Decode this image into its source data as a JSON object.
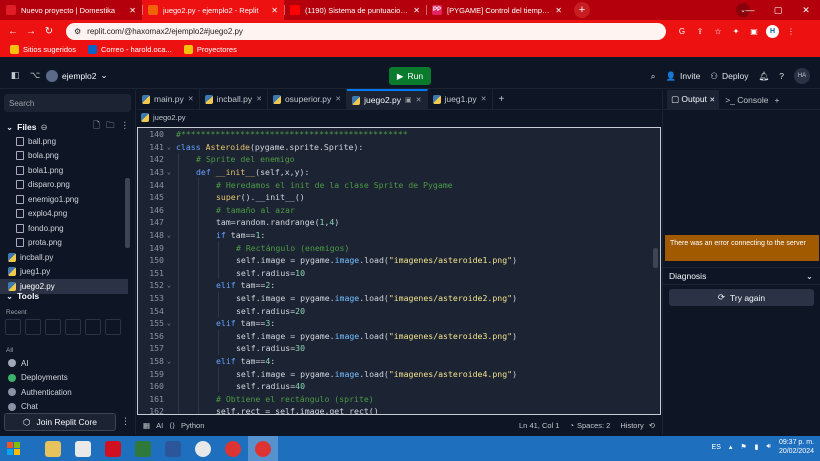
{
  "browser": {
    "tabs": [
      {
        "title": "Nuevo proyecto | Domestika",
        "favicon_color": "#e11d25",
        "favicon_label": ""
      },
      {
        "title": "juego2.py - ejemplo2 - Replit",
        "favicon_color": "#f26207",
        "favicon_label": ""
      },
      {
        "title": "(1190) Sistema de puntuaciones ...",
        "favicon_color": "#ff0000",
        "favicon_label": ""
      },
      {
        "title": "[PYGAME] Control del tiempo en ...",
        "favicon_color": "#e0245e",
        "favicon_label": "PP"
      }
    ],
    "active_tab": 1,
    "url": "replit.com/@haxomax2/ejemplo2#juego2.py",
    "profile_initial": "H",
    "bookmarks": [
      {
        "label": "Sitios sugeridos",
        "color": "#f4c20d"
      },
      {
        "label": "Correo - harold.oca...",
        "color": "#0a64c8"
      },
      {
        "label": "Proyectores",
        "color": "#f4c20d"
      }
    ]
  },
  "replit": {
    "repl_name": "ejemplo2",
    "run_label": "Run",
    "invite_label": "Invite",
    "deploy_label": "Deploy",
    "avatar": "HA",
    "sidebar": {
      "search_placeholder": "Search",
      "files_heading": "Files",
      "files": [
        {
          "name": "ball.png",
          "type": "img",
          "root": false
        },
        {
          "name": "bola.png",
          "type": "img",
          "root": false
        },
        {
          "name": "bola1.png",
          "type": "img",
          "root": false
        },
        {
          "name": "disparo.png",
          "type": "img",
          "root": false
        },
        {
          "name": "enemigo1.png",
          "type": "img",
          "root": false
        },
        {
          "name": "explo4.png",
          "type": "img",
          "root": false
        },
        {
          "name": "fondo.png",
          "type": "img",
          "root": false
        },
        {
          "name": "prota.png",
          "type": "img",
          "root": false
        },
        {
          "name": "incball.py",
          "type": "py",
          "root": true
        },
        {
          "name": "jueg1.py",
          "type": "py",
          "root": true
        },
        {
          "name": "juego2.py",
          "type": "py",
          "root": true
        }
      ],
      "tools_heading": "Tools",
      "recent_label": "Recent",
      "all_label": "All",
      "tools": [
        {
          "label": "AI",
          "color": "#a0a8b8"
        },
        {
          "label": "Deployments",
          "color": "#3bb36a"
        },
        {
          "label": "Authentication",
          "color": "#8a93a5"
        },
        {
          "label": "Chat",
          "color": "#8a93a5"
        }
      ],
      "join_label": "Join Replit Core"
    },
    "editor_tabs": [
      "main.py",
      "incball.py",
      "osuperior.py",
      "juego2.py",
      "jueg1.py"
    ],
    "active_editor_tab": 3,
    "breadcrumb": "juego2.py",
    "status": {
      "ai": "AI",
      "language": "Python",
      "position": "Ln 41, Col 1",
      "spaces": "Spaces: 2",
      "history": "History"
    },
    "right_pane": {
      "tabs": [
        "Output",
        "Console"
      ],
      "error": "There was an error connecting to the server",
      "diagnosis": "Diagnosis",
      "retry": "Try again"
    }
  },
  "code": [
    {
      "n": "140",
      "fold": "",
      "indent": 0,
      "tokens": [
        [
          "cm",
          "#**********************************************"
        ]
      ]
    },
    {
      "n": "141",
      "fold": "⌄",
      "indent": 0,
      "tokens": [
        [
          "kw",
          "class "
        ],
        [
          "fn",
          "Asteroide"
        ],
        [
          "code",
          "(pygame.sprite.Sprite):"
        ]
      ]
    },
    {
      "n": "142",
      "fold": "",
      "indent": 1,
      "tokens": [
        [
          "cm",
          "# Sprite del enemigo"
        ]
      ]
    },
    {
      "n": "143",
      "fold": "⌄",
      "indent": 1,
      "tokens": [
        [
          "kw",
          "def "
        ],
        [
          "fn",
          "__init__"
        ],
        [
          "code",
          "(self,x,y):"
        ]
      ]
    },
    {
      "n": "144",
      "fold": "",
      "indent": 2,
      "tokens": [
        [
          "cm",
          "# Heredamos el init de la clase Sprite de Pygame"
        ]
      ]
    },
    {
      "n": "145",
      "fold": "",
      "indent": 2,
      "tokens": [
        [
          "fn",
          "super"
        ],
        [
          "code",
          "().__init__()"
        ]
      ]
    },
    {
      "n": "146",
      "fold": "",
      "indent": 2,
      "tokens": [
        [
          "cm",
          "# tamaño al azar"
        ]
      ]
    },
    {
      "n": "147",
      "fold": "",
      "indent": 2,
      "tokens": [
        [
          "code",
          "tam=random.randrange("
        ],
        [
          "num",
          "1"
        ],
        [
          "code",
          ","
        ],
        [
          "num",
          "4"
        ],
        [
          "code",
          ")"
        ]
      ]
    },
    {
      "n": "148",
      "fold": "⌄",
      "indent": 2,
      "tokens": [
        [
          "kw",
          "if "
        ],
        [
          "code",
          "tam=="
        ],
        [
          "num",
          "1"
        ],
        [
          "code",
          ":"
        ]
      ]
    },
    {
      "n": "149",
      "fold": "",
      "indent": 3,
      "tokens": [
        [
          "cm",
          "# Rectángulo (enemigos)"
        ]
      ]
    },
    {
      "n": "150",
      "fold": "",
      "indent": 3,
      "tokens": [
        [
          "code",
          "self.image = pygame."
        ],
        [
          "attr",
          "image"
        ],
        [
          "code",
          ".load("
        ],
        [
          "str",
          "\"imagenes/asteroide1.png\""
        ],
        [
          "code",
          ")"
        ]
      ]
    },
    {
      "n": "151",
      "fold": "",
      "indent": 3,
      "tokens": [
        [
          "code",
          "self.radius="
        ],
        [
          "num",
          "10"
        ]
      ]
    },
    {
      "n": "152",
      "fold": "⌄",
      "indent": 2,
      "tokens": [
        [
          "kw",
          "elif "
        ],
        [
          "code",
          "tam=="
        ],
        [
          "num",
          "2"
        ],
        [
          "code",
          ":"
        ]
      ]
    },
    {
      "n": "153",
      "fold": "",
      "indent": 3,
      "tokens": [
        [
          "code",
          "self.image = pygame."
        ],
        [
          "attr",
          "image"
        ],
        [
          "code",
          ".load("
        ],
        [
          "str",
          "\"imagenes/asteroide2.png\""
        ],
        [
          "code",
          ")"
        ]
      ]
    },
    {
      "n": "154",
      "fold": "",
      "indent": 3,
      "tokens": [
        [
          "code",
          "self.radius="
        ],
        [
          "num",
          "20"
        ]
      ]
    },
    {
      "n": "155",
      "fold": "⌄",
      "indent": 2,
      "tokens": [
        [
          "kw",
          "elif "
        ],
        [
          "code",
          "tam=="
        ],
        [
          "num",
          "3"
        ],
        [
          "code",
          ":"
        ]
      ]
    },
    {
      "n": "156",
      "fold": "",
      "indent": 3,
      "tokens": [
        [
          "code",
          "self.image = pygame."
        ],
        [
          "attr",
          "image"
        ],
        [
          "code",
          ".load("
        ],
        [
          "str",
          "\"imagenes/asteroide3.png\""
        ],
        [
          "code",
          ")"
        ]
      ]
    },
    {
      "n": "157",
      "fold": "",
      "indent": 3,
      "tokens": [
        [
          "code",
          "self.radius="
        ],
        [
          "num",
          "30"
        ]
      ]
    },
    {
      "n": "158",
      "fold": "⌄",
      "indent": 2,
      "tokens": [
        [
          "kw",
          "elif "
        ],
        [
          "code",
          "tam=="
        ],
        [
          "num",
          "4"
        ],
        [
          "code",
          ":"
        ]
      ]
    },
    {
      "n": "159",
      "fold": "",
      "indent": 3,
      "tokens": [
        [
          "code",
          "self.image = pygame."
        ],
        [
          "attr",
          "image"
        ],
        [
          "code",
          ".load("
        ],
        [
          "str",
          "\"imagenes/asteroide4.png\""
        ],
        [
          "code",
          ")"
        ]
      ]
    },
    {
      "n": "160",
      "fold": "",
      "indent": 3,
      "tokens": [
        [
          "code",
          "self.radius="
        ],
        [
          "num",
          "40"
        ]
      ]
    },
    {
      "n": "161",
      "fold": "",
      "indent": 2,
      "tokens": [
        [
          "cm",
          "# Obtiene el rectángulo (sprite)"
        ]
      ]
    },
    {
      "n": "162",
      "fold": "",
      "indent": 2,
      "tokens": [
        [
          "code",
          "self.rect = self.image.get_rect()"
        ]
      ]
    }
  ],
  "taskbar": {
    "language": "ES",
    "time": "09:37 p. m.",
    "date": "20/02/2024",
    "apps": [
      {
        "name": "files",
        "color": "#e6c35c"
      },
      {
        "name": "calendar",
        "color": "#e9e9e9"
      },
      {
        "name": "opera",
        "color": "#d01020"
      },
      {
        "name": "game",
        "color": "#2f7a3a"
      },
      {
        "name": "word",
        "color": "#2b579a"
      },
      {
        "name": "chrome",
        "color": "#e8e8e8"
      },
      {
        "name": "chrome-2",
        "color": "#d33"
      },
      {
        "name": "chrome-3",
        "color": "#d33"
      }
    ]
  }
}
